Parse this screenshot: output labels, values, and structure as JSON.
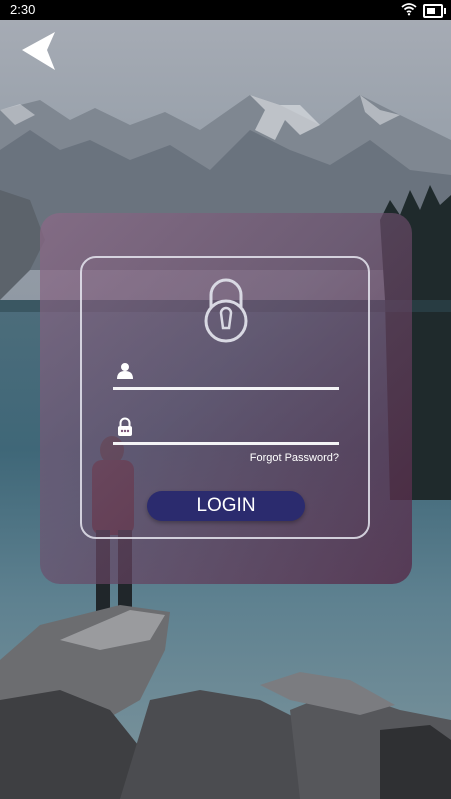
{
  "status_bar": {
    "time": "2:30",
    "icons": [
      "wifi-icon",
      "battery-icon"
    ]
  },
  "header": {
    "back_icon": "back-arrow-icon"
  },
  "login": {
    "lock_icon": "padlock-icon",
    "username": {
      "icon": "user-icon",
      "value": "",
      "placeholder": ""
    },
    "password": {
      "icon": "lock-small-icon",
      "value": "",
      "placeholder": ""
    },
    "forgot_password_label": "Forgot Password?",
    "login_button_label": "LOGIN"
  },
  "colors": {
    "card_tint": "#7a5478",
    "button_bg": "#2b2b6e",
    "status_bar_bg": "#000000",
    "text": "#ffffff"
  }
}
